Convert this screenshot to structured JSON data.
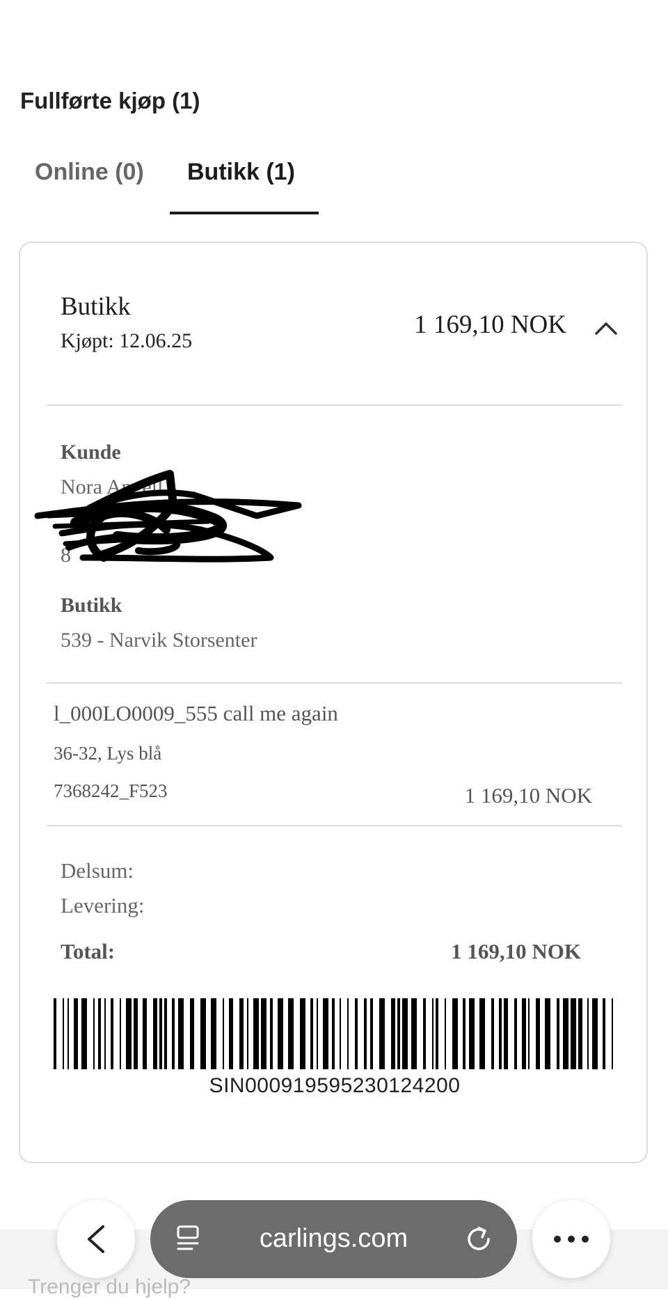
{
  "page": {
    "title": "Fullførte kjøp (1)"
  },
  "tabs": [
    {
      "label": "Online (0)",
      "active": false
    },
    {
      "label": "Butikk (1)",
      "active": true
    }
  ],
  "order": {
    "header": {
      "title": "Butikk",
      "date": "Kjøpt: 12.06.25",
      "total": "1 169,10 NOK",
      "toggle_icon": "chevron-up-icon"
    },
    "customer": {
      "label": "Kunde",
      "name": "Nora Angell",
      "redaction_peek": "8"
    },
    "store": {
      "label": "Butikk",
      "name": "539 - Narvik Storsenter"
    },
    "item": {
      "name": "l_000LO0009_555 call me again",
      "variant": "36-32, Lys blå",
      "sku": "7368242_F523",
      "price": "1 169,10 NOK"
    },
    "summary": {
      "subtotal_label": "Delsum:",
      "shipping_label": "Levering:",
      "total_label": "Total:",
      "total_value": "1 169,10 NOK"
    },
    "barcode": {
      "code": "SIN000919595230124200"
    }
  },
  "browser": {
    "url": "carlings.com",
    "back_icon": "chevron-left-icon",
    "tabs_icon": "page-menu-icon",
    "reload_icon": "reload-icon",
    "more_icon": "more-icon"
  },
  "footer_peek": "Trenger du hjelp?",
  "colors": {
    "underline": "#1b1b1b",
    "border": "#dcdcdc",
    "url_bar": "#6c6c6c"
  }
}
